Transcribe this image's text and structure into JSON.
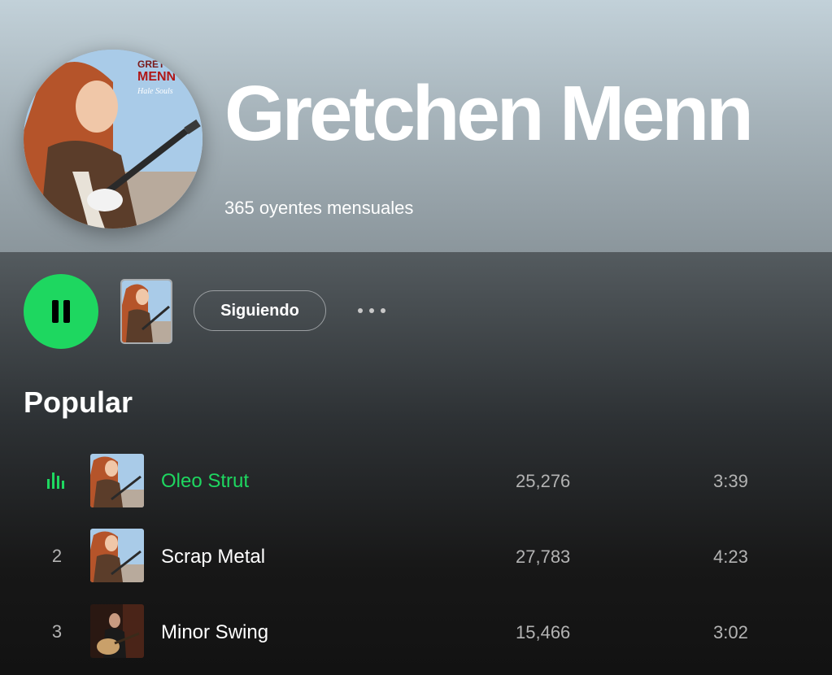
{
  "artist": {
    "name": "Gretchen Menn",
    "listeners": "365 oyentes mensuales",
    "cover_text_1": "GRETCHEN",
    "cover_text_2": "MENN",
    "cover_script": "Hale Souls"
  },
  "controls": {
    "play_state": "pause-icon",
    "follow_label": "Siguiendo",
    "more_icon": "more-horizontal-icon"
  },
  "section": {
    "title": "Popular"
  },
  "colors": {
    "accent": "#1ed760",
    "header": "#a7b4bb",
    "bg": "#121212"
  },
  "tracks": [
    {
      "num": "",
      "playing": true,
      "title": "Oleo Strut",
      "plays": "25,276",
      "duration": "3:39"
    },
    {
      "num": "2",
      "playing": false,
      "title": "Scrap Metal",
      "plays": "27,783",
      "duration": "4:23"
    },
    {
      "num": "3",
      "playing": false,
      "title": "Minor Swing",
      "plays": "15,466",
      "duration": "3:02"
    }
  ]
}
